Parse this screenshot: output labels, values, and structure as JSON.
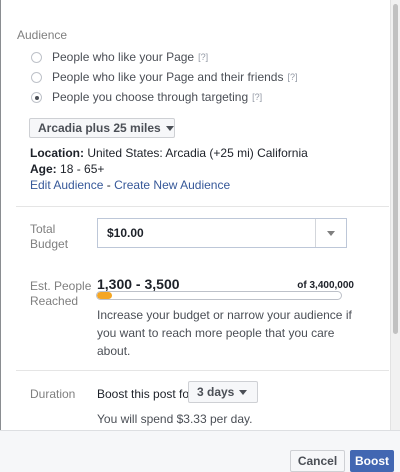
{
  "audience": {
    "section_title": "Audience",
    "options": [
      {
        "label": "People who like your Page",
        "help": "[?]",
        "checked": false
      },
      {
        "label": "People who like your Page and their friends",
        "help": "[?]",
        "checked": false
      },
      {
        "label": "People you choose through targeting",
        "help": "[?]",
        "checked": true
      }
    ],
    "selected_audience": "Arcadia plus 25 miles",
    "location_label": "Location:",
    "location_value": "United States: Arcadia (+25 mi) California",
    "age_label": "Age:",
    "age_value": "18 - 65+",
    "edit_link": "Edit Audience",
    "link_separator": " - ",
    "create_link": "Create New Audience"
  },
  "budget": {
    "label_line1": "Total",
    "label_line2": "Budget",
    "value": "$10.00"
  },
  "reach": {
    "label_line1": "Est. People",
    "label_line2": "Reached",
    "range": "1,300 - 3,500",
    "total": "of 3,400,000",
    "fill_fraction": 0.06,
    "fill_color": "#f5a623",
    "hint_line1": "Increase your budget or narrow your audience if",
    "hint_line2": "you want to reach more people that you care",
    "hint_line3": "about."
  },
  "duration": {
    "label": "Duration",
    "lead": "Boost this post for",
    "value": "3 days",
    "spend": "You will spend $3.33 per day."
  },
  "footer": {
    "cancel_label": "Cancel",
    "boost_label": "Boost",
    "accent_color": "#4267b2"
  }
}
